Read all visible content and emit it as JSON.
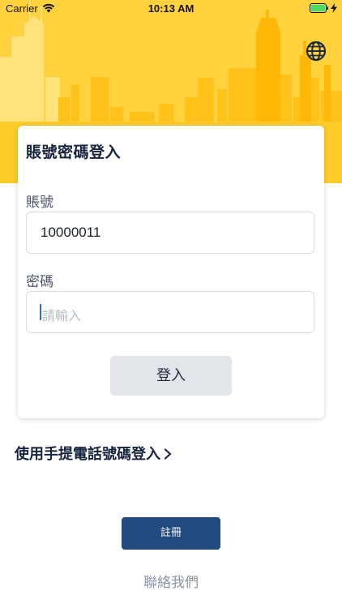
{
  "status_bar": {
    "carrier": "Carrier",
    "time": "10:13 AM"
  },
  "header": {
    "background_color": "#FFD23E",
    "language_icon": "globe-icon"
  },
  "login_card": {
    "title": "賬號密碼登入",
    "account": {
      "label": "賬號",
      "value": "10000011"
    },
    "password": {
      "label": "密碼",
      "placeholder": "請輸入",
      "value": ""
    },
    "login_button": "登入"
  },
  "phone_login_link": "使用手提電話號碼登入",
  "register_button": "註冊",
  "contact_link": "聯絡我們",
  "colors": {
    "primary_navy": "#224A7E",
    "title_text": "#16243E",
    "secondary_button": "#E2E6EB"
  }
}
